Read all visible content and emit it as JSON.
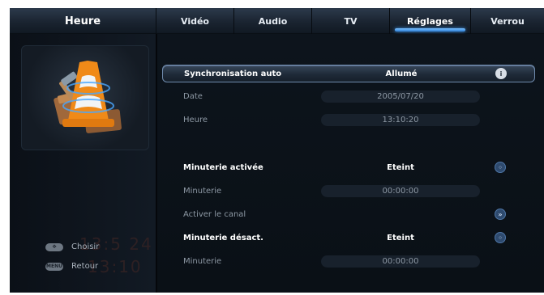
{
  "section_title": "Heure",
  "tabs": [
    {
      "label": "Vidéo"
    },
    {
      "label": "Audio"
    },
    {
      "label": "TV"
    },
    {
      "label": "Réglages"
    },
    {
      "label": "Verrou"
    }
  ],
  "active_tab": "Réglages",
  "legend": {
    "choose": "Choisir",
    "back": "Retour",
    "choose_icon": "dpad-icon",
    "back_icon": "menu-key-icon",
    "back_key_text": "MENU"
  },
  "settings": {
    "sync_auto": {
      "label": "Synchronisation auto",
      "value": "Allumé",
      "icon": "info-icon"
    },
    "date": {
      "label": "Date",
      "value": "2005/07/20"
    },
    "time": {
      "label": "Heure",
      "value": "13:10:20"
    },
    "timer_on": {
      "label": "Minuterie activée",
      "value": "Eteint",
      "icon": "toggle-circle-icon"
    },
    "timer_on_time": {
      "label": "Minuterie",
      "value": "00:00:00"
    },
    "activate_channel": {
      "label": "Activer le canal",
      "icon": "forward-icon"
    },
    "timer_off": {
      "label": "Minuterie désact.",
      "value": "Eteint",
      "icon": "toggle-circle-icon"
    },
    "timer_off_time": {
      "label": "Minuterie",
      "value": "00:00:00"
    }
  },
  "colors": {
    "accent": "#2c7fd4",
    "background": "#05070b",
    "selected_row": "#37475a"
  }
}
